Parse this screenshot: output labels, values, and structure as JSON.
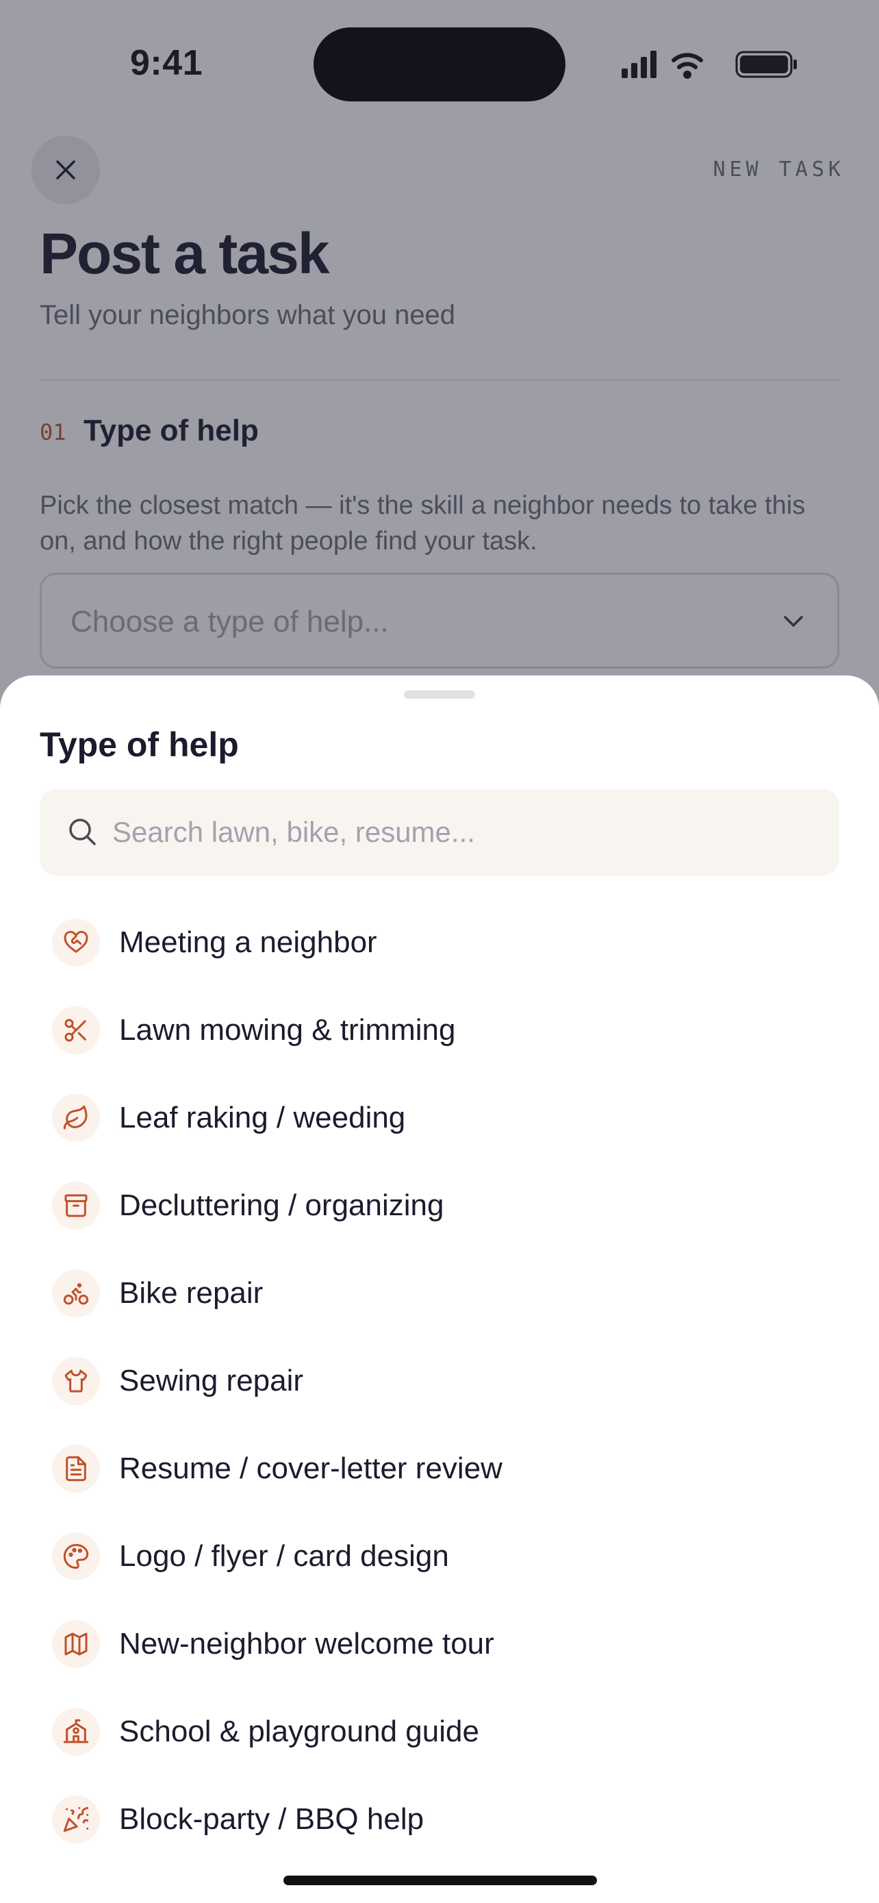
{
  "status_bar": {
    "time": "9:41"
  },
  "header": {
    "eyebrow": "NEW TASK",
    "title": "Post a task",
    "subtitle": "Tell your neighbors what you need"
  },
  "step": {
    "number": "01",
    "title": "Type of help",
    "description": "Pick the closest match — it's the skill a neighbor needs to take this on, and how the right people find your task.",
    "select_placeholder": "Choose a type of help..."
  },
  "sheet": {
    "title": "Type of help",
    "search_placeholder": "Search lawn, bike, resume...",
    "items": [
      {
        "label": "Meeting a neighbor",
        "icon": "heart-handshake-icon"
      },
      {
        "label": "Lawn mowing & trimming",
        "icon": "scissors-icon"
      },
      {
        "label": "Leaf raking / weeding",
        "icon": "leaf-icon"
      },
      {
        "label": "Decluttering / organizing",
        "icon": "archive-box-icon"
      },
      {
        "label": "Bike repair",
        "icon": "bike-icon"
      },
      {
        "label": "Sewing repair",
        "icon": "shirt-icon"
      },
      {
        "label": "Resume / cover-letter review",
        "icon": "document-icon"
      },
      {
        "label": "Logo / flyer / card design",
        "icon": "palette-icon"
      },
      {
        "label": "New-neighbor welcome tour",
        "icon": "map-icon"
      },
      {
        "label": "School & playground guide",
        "icon": "school-icon"
      },
      {
        "label": "Block-party / BBQ help",
        "icon": "party-popper-icon"
      }
    ]
  },
  "colors": {
    "accent": "#c2502b",
    "icon_bg": "#fbf2ec",
    "text_primary": "#1c1b2e",
    "text_muted": "#6b6a78",
    "search_bg": "#f8f5f1"
  }
}
